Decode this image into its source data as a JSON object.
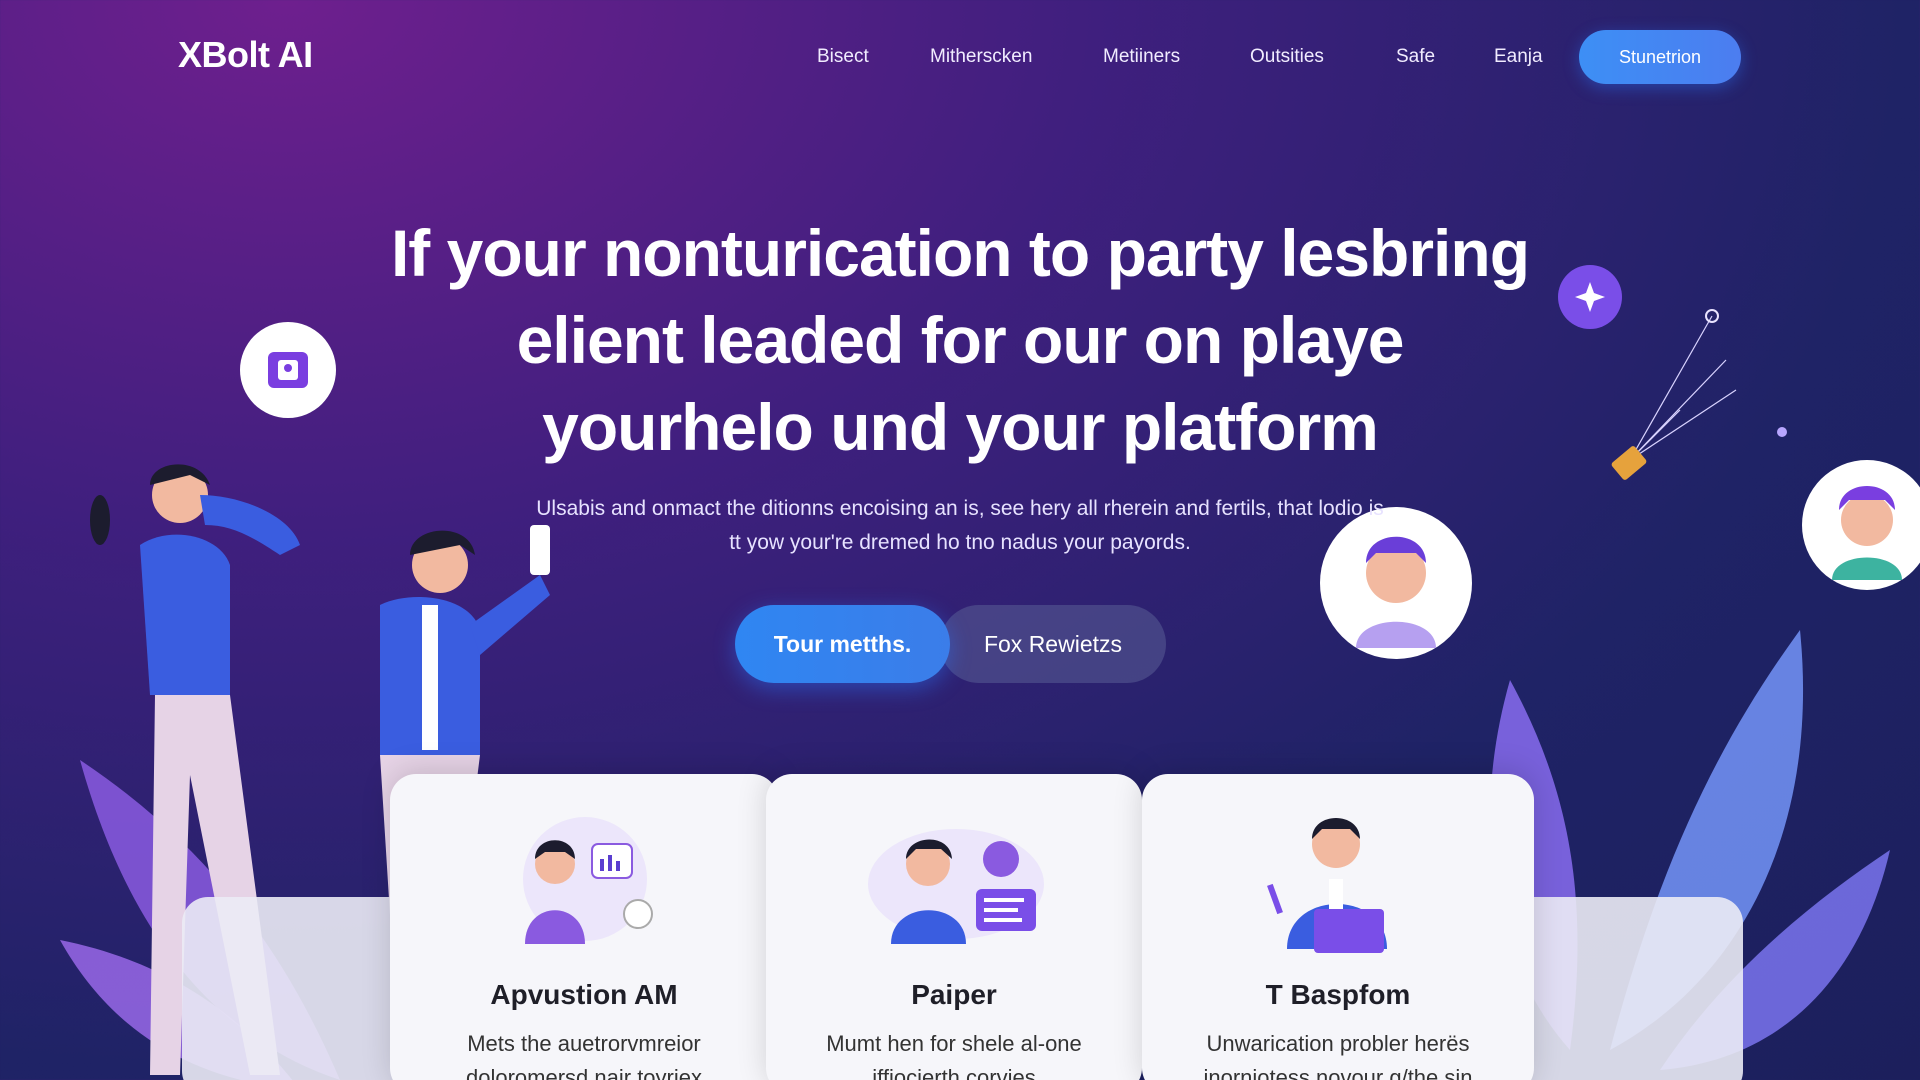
{
  "brand": {
    "logo": "XBolt AI"
  },
  "nav": {
    "links": [
      "Bisect",
      "Mitherscken",
      "Metiiners",
      "Outsities",
      "Safe",
      "Eanja"
    ],
    "cta": "Stunetrion"
  },
  "hero": {
    "title_lines": [
      "If your nonturication to party lesbring",
      "elient leaded for our on playe",
      "yourhelo und your platform"
    ],
    "subtitle_lines": [
      "Ulsabis and onmact the ditionns encoising an is, see hery all rherein and fertils, that lodio is",
      "tt yow your're dremed ho tno nadus your payords."
    ],
    "primary_button": "Tour metths.",
    "secondary_button": "Fox Rewietzs"
  },
  "cards": [
    {
      "title": "Apvustion AM",
      "desc": "Mets the auetrorvmreior doloromersd nair toyriex"
    },
    {
      "title": "Paiper",
      "desc": "Mumt hen for shele al-one iffiocierth corvies"
    },
    {
      "title": "T Baspfom",
      "desc": "Unwarication probler herës inorniotess novour g/the sin onatiges"
    }
  ],
  "colors": {
    "accent_blue": "#3a86f5",
    "bg_purple": "#6e1f8e",
    "bg_navy": "#1f2366"
  }
}
